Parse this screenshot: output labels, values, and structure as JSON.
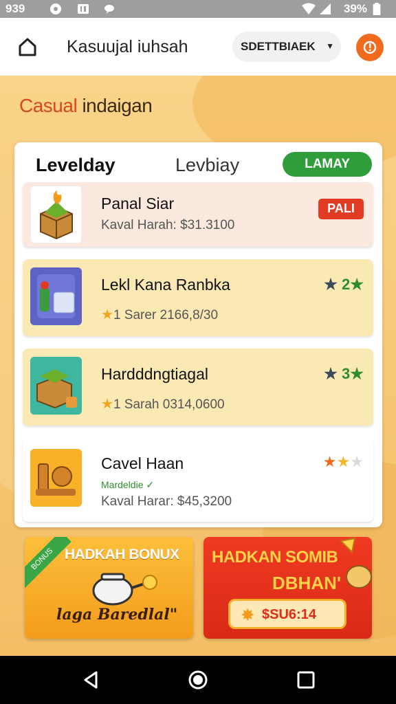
{
  "status_bar": {
    "time": "939",
    "battery": "39%",
    "icons": [
      "notification-icon",
      "image-icon",
      "chat-icon",
      "wifi-icon",
      "signal-icon",
      "battery-icon"
    ]
  },
  "app_bar": {
    "title": "Kasuujal iuhsah",
    "dropdown_label": "SDETTBIAEK",
    "home_icon": "home-icon",
    "alert_icon": "alert-icon"
  },
  "section": {
    "title_part1": "Casual",
    "title_part2": " indaigan"
  },
  "tabs": {
    "active": "Levelday",
    "inactive": "Levbiay",
    "pill": "LAMAY"
  },
  "items": [
    {
      "name": "Panal Siar",
      "subtitle": "Kaval Harah: $31.3100",
      "badge": "PALI",
      "bg": "#fbe8df"
    },
    {
      "name": "Lekl Kana Ranbka",
      "subtitle": "1 Sarer 2166,8/30",
      "rating": "2",
      "bg": "#fbe9b4"
    },
    {
      "name": "Hardddngtiagal",
      "subtitle": "1 Sarah 0314,0600",
      "rating": "3",
      "bg": "#fbe9b4"
    },
    {
      "name": "Cavel Haan",
      "green_note": "Mardeldie",
      "subtitle": "Kaval Harar: $45,3200",
      "bg": "#ffffff"
    }
  ],
  "promos": {
    "left": {
      "title": "HADKAH BONUX",
      "script": "laga Baredlal\"",
      "ribbon": "BONUS"
    },
    "right": {
      "title": "HADKAN SOMIB",
      "title2": "DBHAN'",
      "price": "$SU6:14"
    }
  },
  "colors": {
    "accent_orange": "#f06b1d",
    "green": "#2f9e3a",
    "red": "#e13b23"
  }
}
